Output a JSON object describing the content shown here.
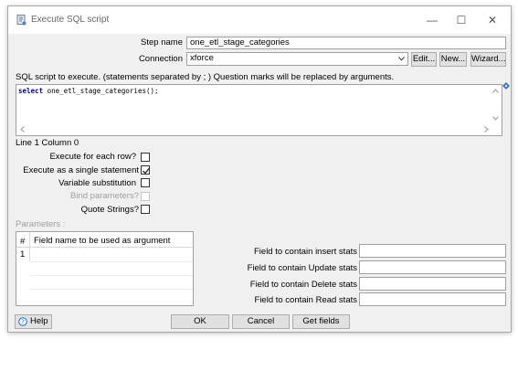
{
  "window": {
    "title": "Execute SQL script",
    "icon": "script-icon",
    "minimize_glyph": "—",
    "maximize_glyph": "☐",
    "close_glyph": "✕"
  },
  "step_name": {
    "label": "Step name",
    "value": "one_etl_stage_categories"
  },
  "connection": {
    "label": "Connection",
    "value": "xforce",
    "edit_label": "Edit...",
    "new_label": "New...",
    "wizard_label": "Wizard..."
  },
  "sql": {
    "label": "SQL script to execute. (statements separated by ; ) Question marks will be replaced by arguments.",
    "keyword": "select",
    "text": " one_etl_stage_categories();",
    "status": "Line 1 Column 0"
  },
  "options": [
    {
      "label": "Execute for each row?",
      "checked": false,
      "disabled": false
    },
    {
      "label": "Execute as a single statement",
      "checked": true,
      "disabled": false
    },
    {
      "label": "Variable substitution",
      "checked": false,
      "disabled": false
    },
    {
      "label": "Bind parameters?",
      "checked": false,
      "disabled": true
    },
    {
      "label": "Quote Strings?",
      "checked": false,
      "disabled": false
    }
  ],
  "parameters": {
    "label": "Parameters :",
    "col_num": "#",
    "col_field": "Field name to be used as argument",
    "rows": [
      {
        "num": "1",
        "field": ""
      }
    ]
  },
  "stats": [
    {
      "label": "Field to contain insert stats",
      "value": ""
    },
    {
      "label": "Field to contain Update stats",
      "value": ""
    },
    {
      "label": "Field to contain Delete stats",
      "value": ""
    },
    {
      "label": "Field to contain Read stats",
      "value": ""
    }
  ],
  "buttons": {
    "help": "Help",
    "ok": "OK",
    "cancel": "Cancel",
    "get_fields": "Get fields"
  },
  "colors": {
    "keyword": "#00008b",
    "disabled_text": "#a0a0a0",
    "accent_help": "#1e6ec8"
  }
}
